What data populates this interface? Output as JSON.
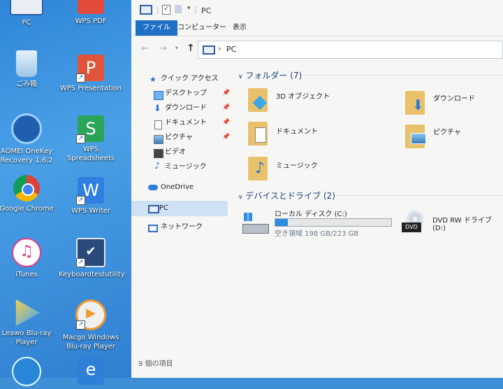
{
  "desktop": {
    "icons": [
      {
        "label": "PC"
      },
      {
        "label": "WPS PDF"
      },
      {
        "label": "ごみ箱"
      },
      {
        "label": "WPS Presentation"
      },
      {
        "label": "AOMEI OneKey\nRecovery 1.6.2"
      },
      {
        "label": "WPS Spreadsheets"
      },
      {
        "label": "Google Chrome"
      },
      {
        "label": "WPS Writer"
      },
      {
        "label": "iTunes"
      },
      {
        "label": "Keyboardtestutility"
      },
      {
        "label": "Leawo Blu-ray\nPlayer"
      },
      {
        "label": "Macgo Windows\nBlu-ray Player"
      }
    ]
  },
  "window": {
    "title": "PC",
    "ribbon_tabs": [
      "ファイル",
      "コンピューター",
      "表示"
    ],
    "address_path": "PC",
    "nav": {
      "quick_access": "クイック アクセス",
      "quick_items": [
        "デスクトップ",
        "ダウンロード",
        "ドキュメント",
        "ピクチャ",
        "ビデオ",
        "ミュージック"
      ],
      "onedrive": "OneDrive",
      "pc": "PC",
      "network": "ネットワーク"
    },
    "folders_header": "フォルダー (7)",
    "folders": [
      "3D オブジェクト",
      "ダウンロード",
      "ドキュメント",
      "ピクチャ",
      "ミュージック"
    ],
    "drives_header": "デバイスとドライブ (2)",
    "drive_c": {
      "name": "ローカル ディスク (C:)",
      "space": "空き領域 198 GB/223 GB",
      "used_fraction": 0.11
    },
    "drive_d": {
      "name": "DVD RW ドライブ (D:)",
      "badge": "DVD"
    },
    "status": "9 個の項目"
  },
  "colors": {
    "accent": "#1f6fc7",
    "selection": "#cfe2f5",
    "folder": "#e8c16a",
    "bar_fill": "#2b8be0"
  }
}
